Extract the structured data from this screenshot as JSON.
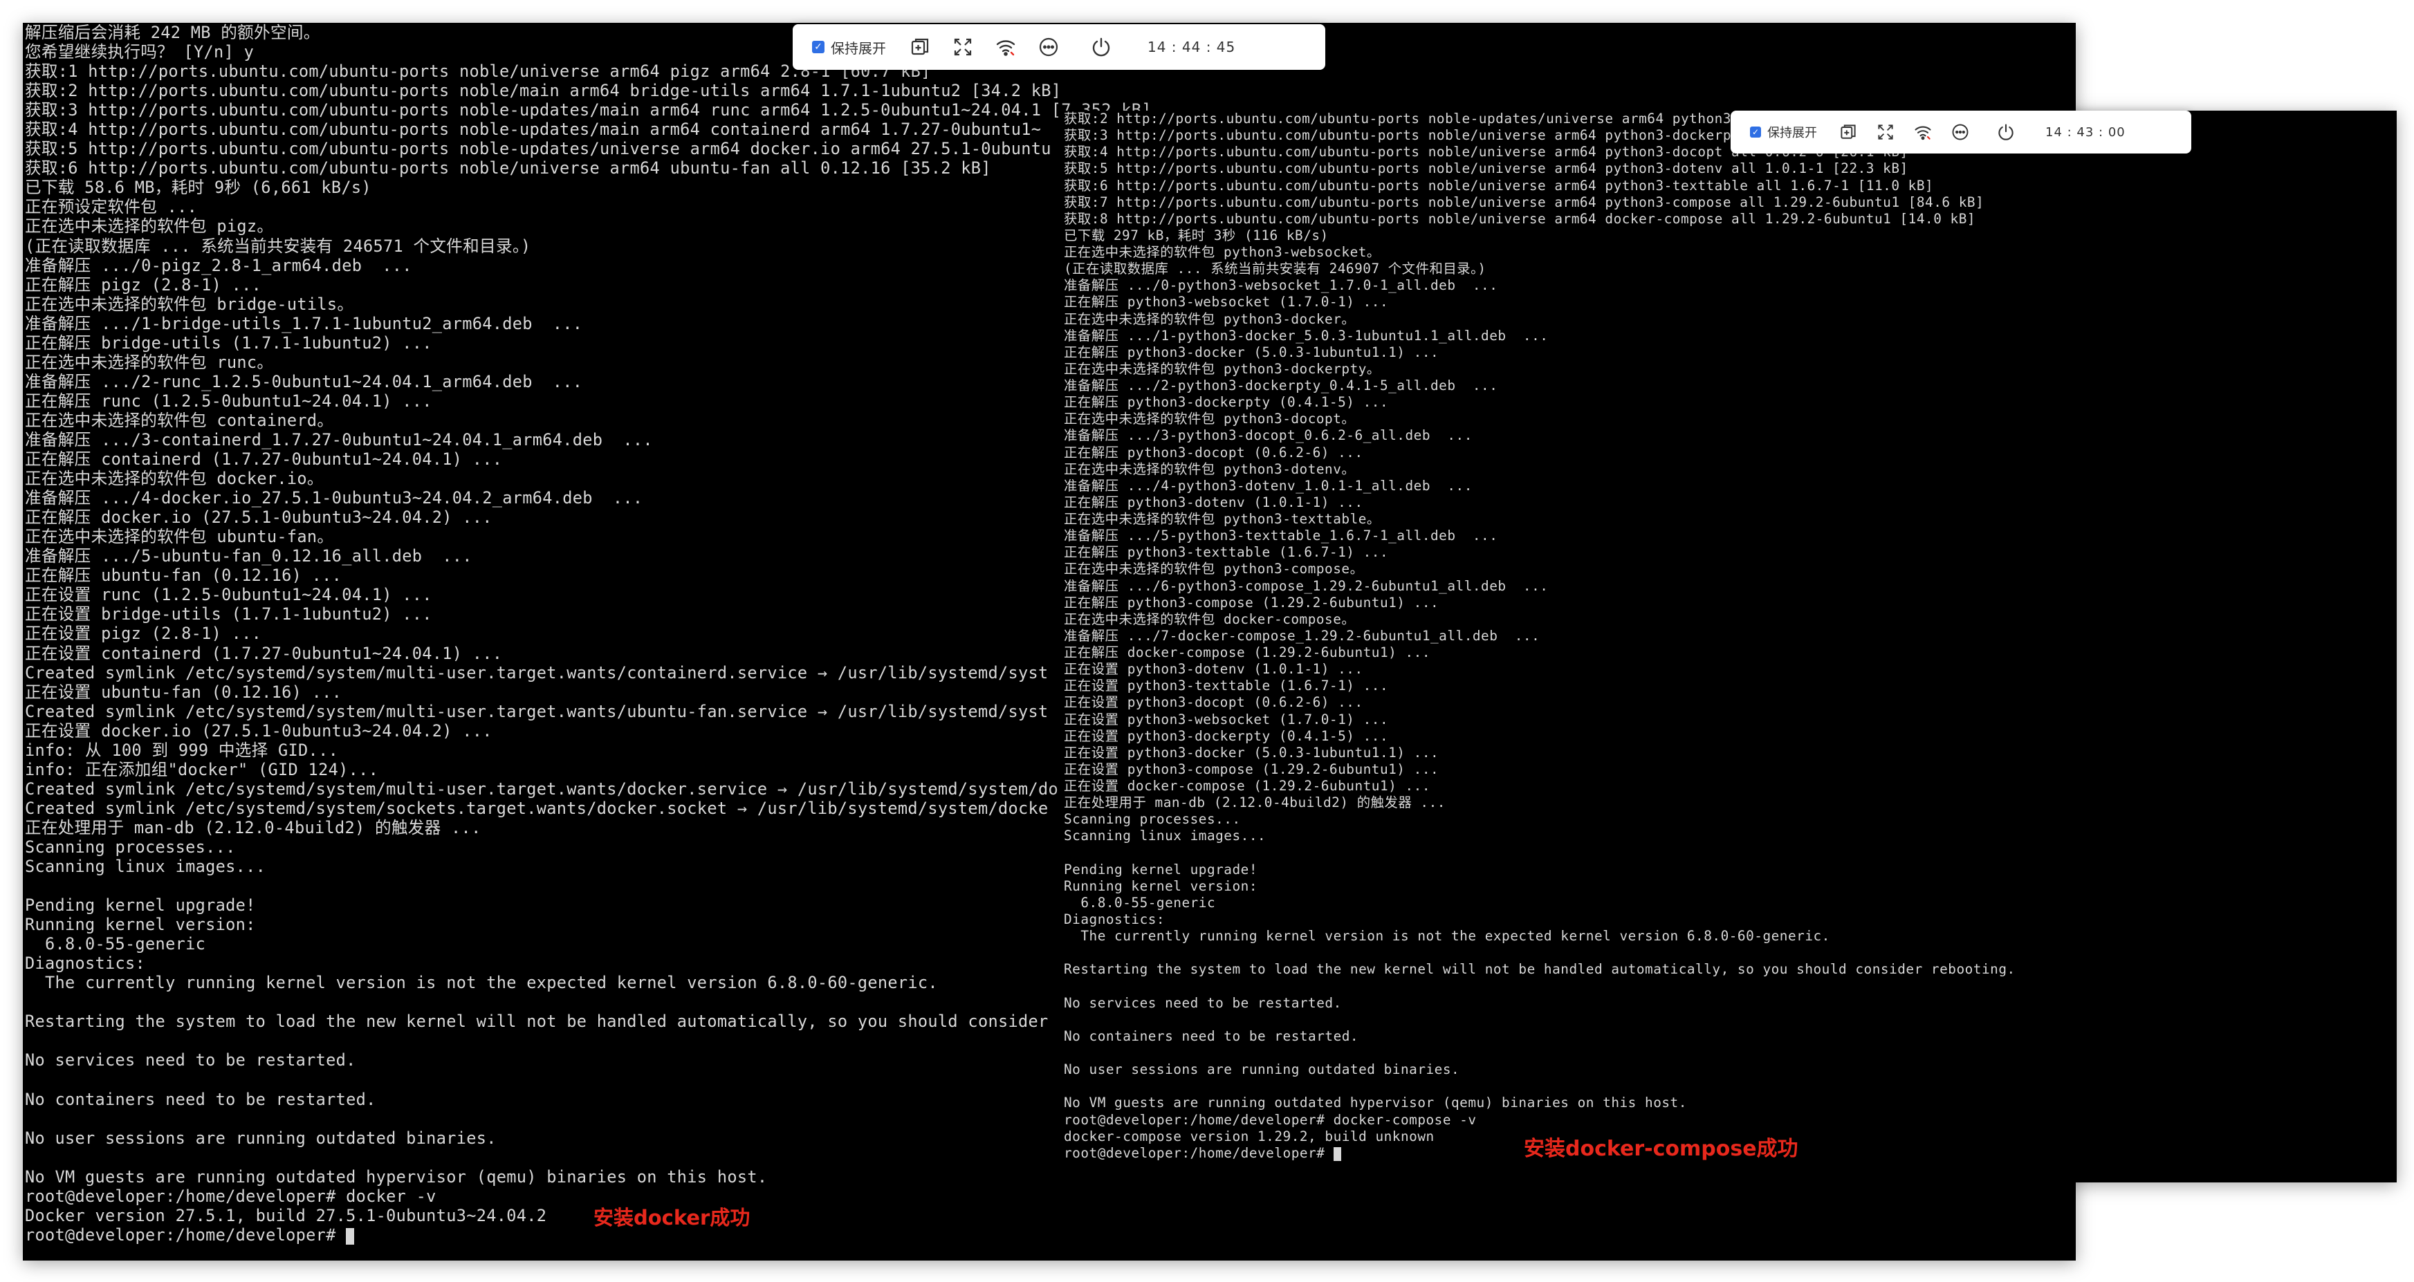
{
  "left_window": {
    "toolbar": {
      "keep_expanded_label": "保持展开",
      "time": "14 : 44 : 45"
    },
    "annotation": "安装docker成功",
    "lines": [
      "解压缩后会消耗 242 MB 的额外空间。",
      "您希望继续执行吗？ [Y/n] y",
      "获取:1 http://ports.ubuntu.com/ubuntu-ports noble/universe arm64 pigz arm64 2.8-1 [60.7 kB]",
      "获取:2 http://ports.ubuntu.com/ubuntu-ports noble/main arm64 bridge-utils arm64 1.7.1-1ubuntu2 [34.2 kB]",
      "获取:3 http://ports.ubuntu.com/ubuntu-ports noble-updates/main arm64 runc arm64 1.2.5-0ubuntu1~24.04.1 [7,352 kB]",
      "获取:4 http://ports.ubuntu.com/ubuntu-ports noble-updates/main arm64 containerd arm64 1.7.27-0ubuntu1~",
      "获取:5 http://ports.ubuntu.com/ubuntu-ports noble-updates/universe arm64 docker.io arm64 27.5.1-0ubuntu",
      "获取:6 http://ports.ubuntu.com/ubuntu-ports noble/universe arm64 ubuntu-fan all 0.12.16 [35.2 kB]",
      "已下载 58.6 MB，耗时 9秒 (6,661 kB/s)",
      "正在预设定软件包 ...",
      "正在选中未选择的软件包 pigz。",
      "(正在读取数据库 ... 系统当前共安装有 246571 个文件和目录。)",
      "准备解压 .../0-pigz_2.8-1_arm64.deb  ...",
      "正在解压 pigz (2.8-1) ...",
      "正在选中未选择的软件包 bridge-utils。",
      "准备解压 .../1-bridge-utils_1.7.1-1ubuntu2_arm64.deb  ...",
      "正在解压 bridge-utils (1.7.1-1ubuntu2) ...",
      "正在选中未选择的软件包 runc。",
      "准备解压 .../2-runc_1.2.5-0ubuntu1~24.04.1_arm64.deb  ...",
      "正在解压 runc (1.2.5-0ubuntu1~24.04.1) ...",
      "正在选中未选择的软件包 containerd。",
      "准备解压 .../3-containerd_1.7.27-0ubuntu1~24.04.1_arm64.deb  ...",
      "正在解压 containerd (1.7.27-0ubuntu1~24.04.1) ...",
      "正在选中未选择的软件包 docker.io。",
      "准备解压 .../4-docker.io_27.5.1-0ubuntu3~24.04.2_arm64.deb  ...",
      "正在解压 docker.io (27.5.1-0ubuntu3~24.04.2) ...",
      "正在选中未选择的软件包 ubuntu-fan。",
      "准备解压 .../5-ubuntu-fan_0.12.16_all.deb  ...",
      "正在解压 ubuntu-fan (0.12.16) ...",
      "正在设置 runc (1.2.5-0ubuntu1~24.04.1) ...",
      "正在设置 bridge-utils (1.7.1-1ubuntu2) ...",
      "正在设置 pigz (2.8-1) ...",
      "正在设置 containerd (1.7.27-0ubuntu1~24.04.1) ...",
      "Created symlink /etc/systemd/system/multi-user.target.wants/containerd.service → /usr/lib/systemd/syst",
      "正在设置 ubuntu-fan (0.12.16) ...",
      "Created symlink /etc/systemd/system/multi-user.target.wants/ubuntu-fan.service → /usr/lib/systemd/syst",
      "正在设置 docker.io (27.5.1-0ubuntu3~24.04.2) ...",
      "info: 从 100 到 999 中选择 GID...",
      "info: 正在添加组\"docker\" (GID 124)...",
      "Created symlink /etc/systemd/system/multi-user.target.wants/docker.service → /usr/lib/systemd/system/do",
      "Created symlink /etc/systemd/system/sockets.target.wants/docker.socket → /usr/lib/systemd/system/docke",
      "正在处理用于 man-db (2.12.0-4build2) 的触发器 ...",
      "Scanning processes...",
      "Scanning linux images...",
      "",
      "Pending kernel upgrade!",
      "Running kernel version:",
      "  6.8.0-55-generic",
      "Diagnostics:",
      "  The currently running kernel version is not the expected kernel version 6.8.0-60-generic.",
      "",
      "Restarting the system to load the new kernel will not be handled automatically, so you should consider",
      "",
      "No services need to be restarted.",
      "",
      "No containers need to be restarted.",
      "",
      "No user sessions are running outdated binaries.",
      "",
      "No VM guests are running outdated hypervisor (qemu) binaries on this host.",
      "root@developer:/home/developer# docker -v",
      "Docker version 27.5.1, build 27.5.1-0ubuntu3~24.04.2",
      "root@developer:/home/developer# "
    ]
  },
  "right_window": {
    "toolbar": {
      "keep_expanded_label": "保持展开",
      "time": "14 : 43 : 00"
    },
    "annotation": "安装docker-compose成功",
    "lines": [
      "获取:2 http://ports.ubuntu.com/ubuntu-ports noble-updates/universe arm64 python3-docker all 5.0.3-1ubuntu1.1 [89.1 kB]",
      "获取:3 http://ports.ubuntu.com/ubuntu-ports noble/universe arm64 python3-dockerpty all 0.4.1-5 [11.4 kB]",
      "获取:4 http://ports.ubuntu.com/ubuntu-ports noble/universe arm64 python3-docopt all 0.6.2-6 [26.1 kB]",
      "获取:5 http://ports.ubuntu.com/ubuntu-ports noble/universe arm64 python3-dotenv all 1.0.1-1 [22.3 kB]",
      "获取:6 http://ports.ubuntu.com/ubuntu-ports noble/universe arm64 python3-texttable all 1.6.7-1 [11.0 kB]",
      "获取:7 http://ports.ubuntu.com/ubuntu-ports noble/universe arm64 python3-compose all 1.29.2-6ubuntu1 [84.6 kB]",
      "获取:8 http://ports.ubuntu.com/ubuntu-ports noble/universe arm64 docker-compose all 1.29.2-6ubuntu1 [14.0 kB]",
      "已下载 297 kB，耗时 3秒 (116 kB/s)",
      "正在选中未选择的软件包 python3-websocket。",
      "(正在读取数据库 ... 系统当前共安装有 246907 个文件和目录。)",
      "准备解压 .../0-python3-websocket_1.7.0-1_all.deb  ...",
      "正在解压 python3-websocket (1.7.0-1) ...",
      "正在选中未选择的软件包 python3-docker。",
      "准备解压 .../1-python3-docker_5.0.3-1ubuntu1.1_all.deb  ...",
      "正在解压 python3-docker (5.0.3-1ubuntu1.1) ...",
      "正在选中未选择的软件包 python3-dockerpty。",
      "准备解压 .../2-python3-dockerpty_0.4.1-5_all.deb  ...",
      "正在解压 python3-dockerpty (0.4.1-5) ...",
      "正在选中未选择的软件包 python3-docopt。",
      "准备解压 .../3-python3-docopt_0.6.2-6_all.deb  ...",
      "正在解压 python3-docopt (0.6.2-6) ...",
      "正在选中未选择的软件包 python3-dotenv。",
      "准备解压 .../4-python3-dotenv_1.0.1-1_all.deb  ...",
      "正在解压 python3-dotenv (1.0.1-1) ...",
      "正在选中未选择的软件包 python3-texttable。",
      "准备解压 .../5-python3-texttable_1.6.7-1_all.deb  ...",
      "正在解压 python3-texttable (1.6.7-1) ...",
      "正在选中未选择的软件包 python3-compose。",
      "准备解压 .../6-python3-compose_1.29.2-6ubuntu1_all.deb  ...",
      "正在解压 python3-compose (1.29.2-6ubuntu1) ...",
      "正在选中未选择的软件包 docker-compose。",
      "准备解压 .../7-docker-compose_1.29.2-6ubuntu1_all.deb  ...",
      "正在解压 docker-compose (1.29.2-6ubuntu1) ...",
      "正在设置 python3-dotenv (1.0.1-1) ...",
      "正在设置 python3-texttable (1.6.7-1) ...",
      "正在设置 python3-docopt (0.6.2-6) ...",
      "正在设置 python3-websocket (1.7.0-1) ...",
      "正在设置 python3-dockerpty (0.4.1-5) ...",
      "正在设置 python3-docker (5.0.3-1ubuntu1.1) ...",
      "正在设置 python3-compose (1.29.2-6ubuntu1) ...",
      "正在设置 docker-compose (1.29.2-6ubuntu1) ...",
      "正在处理用于 man-db (2.12.0-4build2) 的触发器 ...",
      "Scanning processes...",
      "Scanning linux images...",
      "",
      "Pending kernel upgrade!",
      "Running kernel version:",
      "  6.8.0-55-generic",
      "Diagnostics:",
      "  The currently running kernel version is not the expected kernel version 6.8.0-60-generic.",
      "",
      "Restarting the system to load the new kernel will not be handled automatically, so you should consider rebooting.",
      "",
      "No services need to be restarted.",
      "",
      "No containers need to be restarted.",
      "",
      "No user sessions are running outdated binaries.",
      "",
      "No VM guests are running outdated hypervisor (qemu) binaries on this host.",
      "root@developer:/home/developer# docker-compose -v",
      "docker-compose version 1.29.2, build unknown",
      "root@developer:/home/developer# "
    ]
  }
}
